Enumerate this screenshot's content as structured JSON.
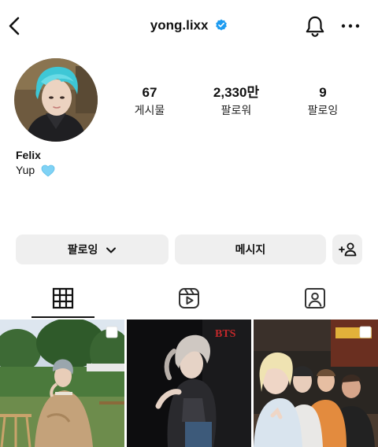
{
  "header": {
    "username": "yong.lixx",
    "verified": true,
    "icons": {
      "back": "chevron-left-icon",
      "verified": "verified-badge-icon",
      "notifications": "bell-icon",
      "more": "more-horizontal-icon"
    }
  },
  "profile": {
    "stats": {
      "posts": {
        "value": "67",
        "label": "게시물"
      },
      "followers": {
        "value": "2,330만",
        "label": "팔로워"
      },
      "following": {
        "value": "9",
        "label": "팔로잉"
      }
    },
    "name": "Felix",
    "bio": "Yup",
    "bio_emoji": "light-blue-heart-icon"
  },
  "actions": {
    "following_label": "팔로잉",
    "message_label": "메시지",
    "add_user_icon": "add-person-icon"
  },
  "tabs": [
    {
      "icon": "grid-icon",
      "active": true
    },
    {
      "icon": "reels-icon",
      "active": false
    },
    {
      "icon": "tagged-icon",
      "active": false
    }
  ],
  "posts": [
    {
      "description": "garden-portrait",
      "multi": true
    },
    {
      "description": "magazine-cover",
      "multi": false
    },
    {
      "description": "group-selfie",
      "multi": true
    }
  ],
  "colors": {
    "verified_blue": "#1d9bf0",
    "button_bg": "#efefef",
    "heart_blue": "#7fd2f5",
    "text": "#111111"
  }
}
